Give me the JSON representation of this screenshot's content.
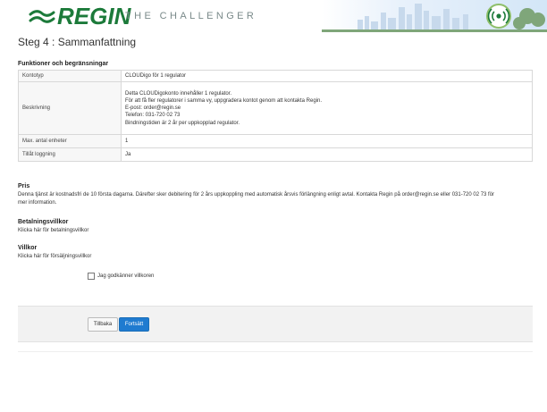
{
  "header": {
    "logo_text": "REGIN",
    "tagline": "THE CHALLENGER"
  },
  "page_title": "Steg 4 : Sammanfattning",
  "features": {
    "heading": "Funktioner och begränsningar",
    "rows": [
      {
        "key": "Kontotyp",
        "lines": [
          "CLOUDigo för 1 regulator"
        ]
      },
      {
        "key": "Beskrivning",
        "lines": [
          "Detta CLOUDigokonto innehåller 1 regulator.",
          "För att få fler regulatorer i samma vy, uppgradera kontot genom att kontakta Regin.",
          "E-post: order@regin.se",
          "Telefon: 031-720 02 73",
          "Bindningstiden är 2 år per uppkopplad regulator."
        ]
      },
      {
        "key": "Max. antal enheter",
        "lines": [
          "1"
        ]
      },
      {
        "key": "Tillåt loggning",
        "lines": [
          "Ja"
        ]
      }
    ]
  },
  "price": {
    "heading": "Pris",
    "text_line1": "Denna tjänst är kostnadsfri de 10 första dagarna. Därefter sker debitering för 2 års uppkoppling med automatisk årsvis förlängning enligt avtal. Kontakta Regin på order@regin.se eller 031-720 02 73 för",
    "text_line2": "mer information."
  },
  "payment_terms": {
    "heading": "Betalningsvillkor",
    "link": "Klicka här för betalningsvillkor"
  },
  "terms": {
    "heading": "Villkor",
    "link": "Klicka här för försäljningsvillkor"
  },
  "accept_label": "Jag godkänner villkoren",
  "buttons": {
    "back": "Tillbaka",
    "next": "Fortsätt"
  },
  "colors": {
    "brand_green": "#1c7a3a",
    "primary_button": "#1f7bd0"
  }
}
